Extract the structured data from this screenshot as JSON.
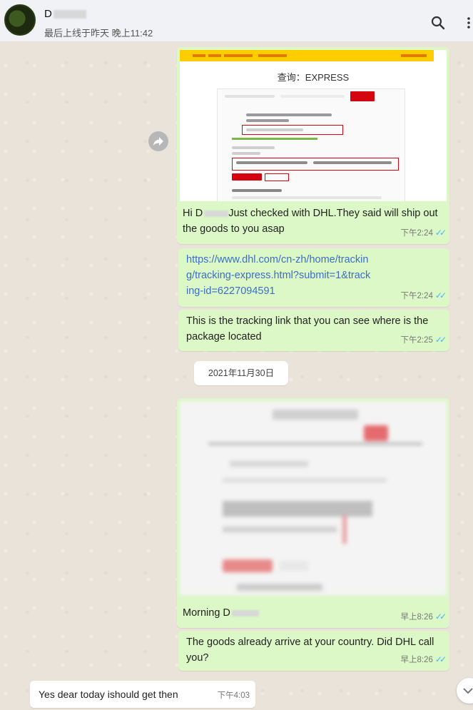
{
  "header": {
    "contact_name": "D",
    "last_seen": "最后上线于昨天 晚上11:42"
  },
  "dhl_screenshot": {
    "title": "查询：EXPRESS"
  },
  "messages": [
    {
      "text_prefix": "Hi D",
      "text": "Just checked with DHL.They said will ship out the goods to you asap",
      "time": "下午2:24"
    },
    {
      "link": "https://www.dhl.com/cn-zh/home/tracking/tracking-express.html?submit=1&tracking-id=6227094591",
      "time": "下午2:24"
    },
    {
      "text": "This is the tracking link that you can see where is the package located",
      "time": "下午2:25"
    },
    {
      "date_separator": "2021年11月30日"
    },
    {
      "text_prefix": "Morning D",
      "time": "早上8:26"
    },
    {
      "text": "The goods already arrive at your country. Did DHL call you?",
      "time": "早上8:26"
    },
    {
      "text": "Yes dear today ishould get then",
      "time": "下午4:03",
      "incoming": true
    }
  ],
  "icons": {
    "search": "search-icon",
    "menu": "menu-icon",
    "forward": "forward-icon",
    "read_ticks": "double-check-icon",
    "scroll_down": "chevron-down-icon"
  },
  "colors": {
    "outgoing_bubble": "#dcf8c6",
    "incoming_bubble": "#ffffff",
    "read_tick": "#4fb6ec",
    "dhl_yellow": "#ffcc00",
    "dhl_red": "#d40511"
  }
}
